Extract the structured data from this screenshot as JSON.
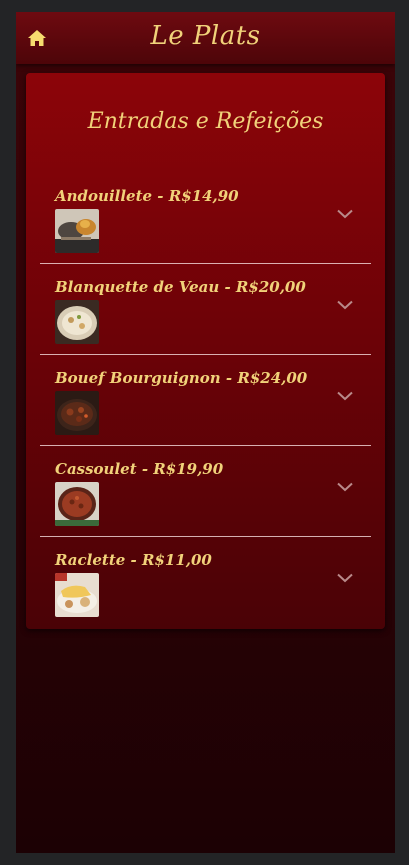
{
  "header": {
    "brand": "Le Plats",
    "home_icon": "home-icon"
  },
  "section": {
    "title": "Entradas e Refeições"
  },
  "colors": {
    "gold": "#f1d27a",
    "burgundy": "#8c0409",
    "chevron": "#b98a8a"
  },
  "items": [
    {
      "title": "Andouillete - R$14,90",
      "icon": "chevron-down-icon"
    },
    {
      "title": "Blanquette de Veau - R$20,00",
      "icon": "chevron-down-icon"
    },
    {
      "title": "Bouef Bourguignon - R$24,00",
      "icon": "chevron-down-icon"
    },
    {
      "title": "Cassoulet - R$19,90",
      "icon": "chevron-down-icon"
    },
    {
      "title": "Raclette - R$11,00",
      "icon": "chevron-down-icon"
    }
  ]
}
